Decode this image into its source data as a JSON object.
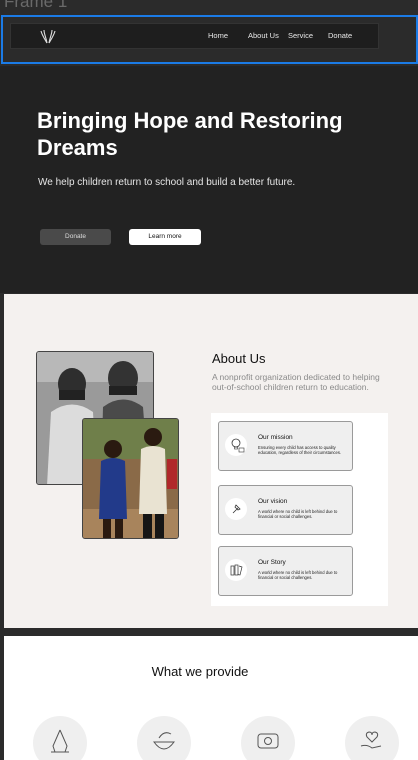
{
  "frame": {
    "label": "Frame 1"
  },
  "nav": {
    "logo_icon": "open-hands-icon",
    "links": [
      {
        "label": "Home"
      },
      {
        "label": "About Us"
      },
      {
        "label": "Service"
      },
      {
        "label": "Donate"
      }
    ]
  },
  "hero": {
    "title": "Bringing Hope and Restoring Dreams",
    "subtitle": "We help children return to school and build a better future.",
    "primary_button": "Donate",
    "secondary_button": "Learn more"
  },
  "about": {
    "title": "About Us",
    "description": "A nonprofit organization dedicated to helping out-of-school children return to education.",
    "cards": [
      {
        "title": "Our mission",
        "text": "Ensuring every child has access to quality education, regardless of their circumstances.",
        "icon": "lightbulb-book-icon"
      },
      {
        "title": "Our vision",
        "text": "A world where no child is left behind due to financial or social challenges.",
        "icon": "pin-icon"
      },
      {
        "title": "Our Story",
        "text": "A world where no child is left behind due to financial or social challenges.",
        "icon": "books-icon"
      }
    ]
  },
  "provide": {
    "title": "What we provide",
    "icons": [
      "praying-hands-icon",
      "bowl-icon",
      "camera-icon",
      "heart-hand-icon"
    ]
  },
  "colors": {
    "selection": "#1b7be6",
    "hero_bg": "#222222",
    "about_bg": "#f4f1ef"
  }
}
